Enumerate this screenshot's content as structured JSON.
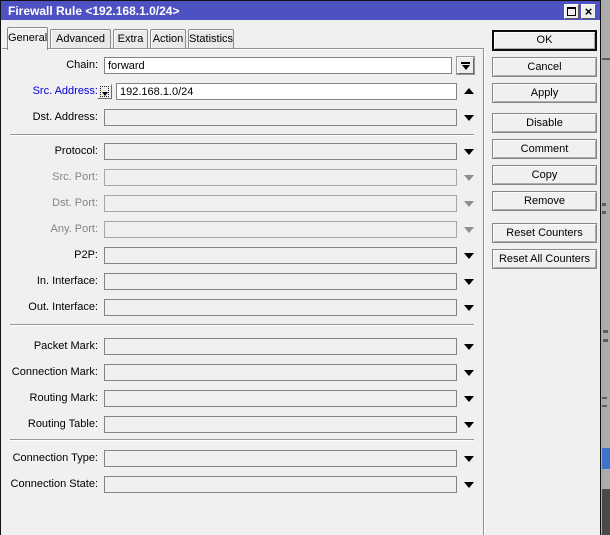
{
  "window": {
    "title": "Firewall Rule <192.168.1.0/24>",
    "close_glyph": "×"
  },
  "tabs": [
    {
      "label": "General",
      "active": true
    },
    {
      "label": "Advanced",
      "active": false
    },
    {
      "label": "Extra",
      "active": false
    },
    {
      "label": "Action",
      "active": false
    },
    {
      "label": "Statistics",
      "active": false
    }
  ],
  "form": {
    "rows": [
      {
        "label": "Chain:",
        "value": "forward",
        "state": "enabled"
      },
      {
        "label": "Src. Address:",
        "value": "192.168.1.0/24",
        "state": "active"
      },
      {
        "label": "Dst. Address:",
        "value": "",
        "state": "enabled"
      },
      {
        "label": "Protocol:",
        "value": "",
        "state": "enabled"
      },
      {
        "label": "Src. Port:",
        "value": "",
        "state": "disabled"
      },
      {
        "label": "Dst. Port:",
        "value": "",
        "state": "disabled"
      },
      {
        "label": "Any. Port:",
        "value": "",
        "state": "disabled"
      },
      {
        "label": "P2P:",
        "value": "",
        "state": "enabled"
      },
      {
        "label": "In. Interface:",
        "value": "",
        "state": "enabled"
      },
      {
        "label": "Out. Interface:",
        "value": "",
        "state": "enabled"
      },
      {
        "label": "Packet Mark:",
        "value": "",
        "state": "enabled"
      },
      {
        "label": "Connection Mark:",
        "value": "",
        "state": "enabled"
      },
      {
        "label": "Routing Mark:",
        "value": "",
        "state": "enabled"
      },
      {
        "label": "Routing Table:",
        "value": "",
        "state": "enabled"
      },
      {
        "label": "Connection Type:",
        "value": "",
        "state": "enabled"
      },
      {
        "label": "Connection State:",
        "value": "",
        "state": "enabled"
      }
    ]
  },
  "buttons": [
    {
      "label": "OK",
      "default": true
    },
    {
      "label": "Cancel",
      "default": false
    },
    {
      "label": "Apply",
      "default": false
    },
    {
      "label": "Disable",
      "default": false
    },
    {
      "label": "Comment",
      "default": false
    },
    {
      "label": "Copy",
      "default": false
    },
    {
      "label": "Remove",
      "default": false
    },
    {
      "label": "Reset Counters",
      "default": false
    },
    {
      "label": "Reset All Counters",
      "default": false
    }
  ],
  "colors": {
    "titlebar": "#4e51c2",
    "dialog_bg": "#f0f0f0",
    "active_label_blue": "#0000d8",
    "disabled_text": "#848484",
    "selection_blue_sliver": "#3e73c8"
  }
}
